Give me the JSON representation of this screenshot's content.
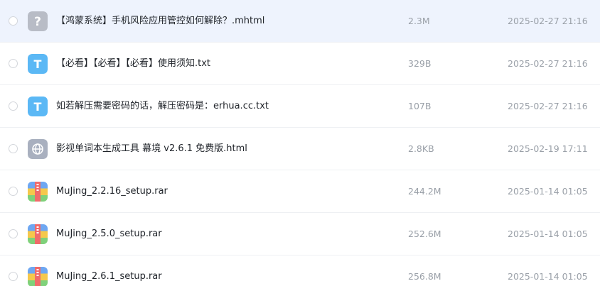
{
  "files": [
    {
      "name": "【鸿蒙系统】手机风险应用管控如何解除？.mhtml",
      "size": "2.3M",
      "date": "2025-02-27 21:16",
      "icon": "unknown-file-icon",
      "glyph": "?"
    },
    {
      "name": "【必看】【必看】【必看】使用须知.txt",
      "size": "329B",
      "date": "2025-02-27 21:16",
      "icon": "text-file-icon",
      "glyph": "T"
    },
    {
      "name": "如若解压需要密码的话，解压密码是：erhua.cc.txt",
      "size": "107B",
      "date": "2025-02-27 21:16",
      "icon": "text-file-icon",
      "glyph": "T"
    },
    {
      "name": "影视单词本生成工具 幕境 v2.6.1 免费版.html",
      "size": "2.8KB",
      "date": "2025-02-19 17:11",
      "icon": "web-file-icon"
    },
    {
      "name": "MuJing_2.2.16_setup.rar",
      "size": "244.2M",
      "date": "2025-01-14 01:05",
      "icon": "archive-file-icon"
    },
    {
      "name": "MuJing_2.5.0_setup.rar",
      "size": "252.6M",
      "date": "2025-01-14 01:05",
      "icon": "archive-file-icon"
    },
    {
      "name": "MuJing_2.6.1_setup.rar",
      "size": "256.8M",
      "date": "2025-01-14 01:05",
      "icon": "archive-file-icon"
    }
  ],
  "colors": {
    "hover_row_bg": "#eef3fd",
    "text_icon": "#5bb8f5",
    "unknown_icon": "#b8bcc6",
    "web_icon": "#a9b0bf"
  }
}
